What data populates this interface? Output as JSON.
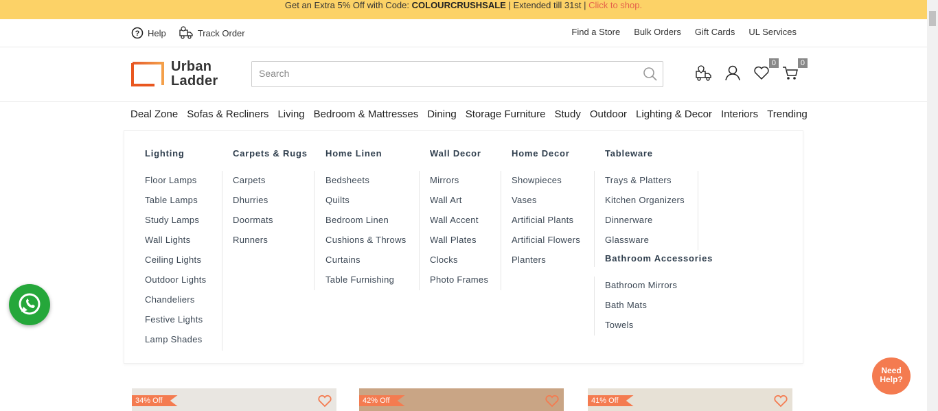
{
  "promo": {
    "text_before": "Get an Extra 5% Off with Code: ",
    "code": "COLOURCRUSHSALE",
    "text_after": " | Extended till 31st | ",
    "cta": "Click to shop."
  },
  "topbar": {
    "help": "Help",
    "track_order": "Track Order",
    "links": [
      "Find a Store",
      "Bulk Orders",
      "Gift Cards",
      "UL Services"
    ]
  },
  "header": {
    "logo_line1": "Urban",
    "logo_line2": "Ladder",
    "search_placeholder": "Search",
    "wishlist_count": "0",
    "cart_count": "0"
  },
  "nav": [
    "Deal Zone",
    "Sofas & Recliners",
    "Living",
    "Bedroom & Mattresses",
    "Dining",
    "Storage Furniture",
    "Study",
    "Outdoor",
    "Lighting & Decor",
    "Interiors",
    "Trending"
  ],
  "mega": {
    "lighting": {
      "title": "Lighting",
      "items": [
        "Floor Lamps",
        "Table Lamps",
        "Study Lamps",
        "Wall Lights",
        "Ceiling Lights",
        "Outdoor Lights",
        "Chandeliers",
        "Festive Lights",
        "Lamp Shades"
      ]
    },
    "carpets": {
      "title": "Carpets & Rugs",
      "items": [
        "Carpets",
        "Dhurries",
        "Doormats",
        "Runners"
      ]
    },
    "linen": {
      "title": "Home Linen",
      "items": [
        "Bedsheets",
        "Quilts",
        "Bedroom Linen",
        "Cushions & Throws",
        "Curtains",
        "Table Furnishing"
      ]
    },
    "wall": {
      "title": "Wall Decor",
      "items": [
        "Mirrors",
        "Wall Art",
        "Wall Accent",
        "Wall Plates",
        "Clocks",
        "Photo Frames"
      ]
    },
    "decor": {
      "title": "Home Decor",
      "items": [
        "Showpieces",
        "Vases",
        "Artificial Plants",
        "Artificial Flowers",
        "Planters"
      ]
    },
    "tableware": {
      "title": "Tableware",
      "items": [
        "Trays & Platters",
        "Kitchen Organizers",
        "Dinnerware",
        "Glassware"
      ]
    },
    "bath": {
      "title": "Bathroom Accessories",
      "items": [
        "Bathroom Mirrors",
        "Bath Mats",
        "Towels"
      ]
    }
  },
  "need_help": "Need Help?",
  "cards": [
    {
      "discount": "34% Off"
    },
    {
      "discount": "42% Off"
    },
    {
      "discount": "41% Off"
    }
  ],
  "colors": {
    "promo_bg": "#fcd267",
    "accent": "#f47b50",
    "whatsapp": "#25a73a"
  }
}
